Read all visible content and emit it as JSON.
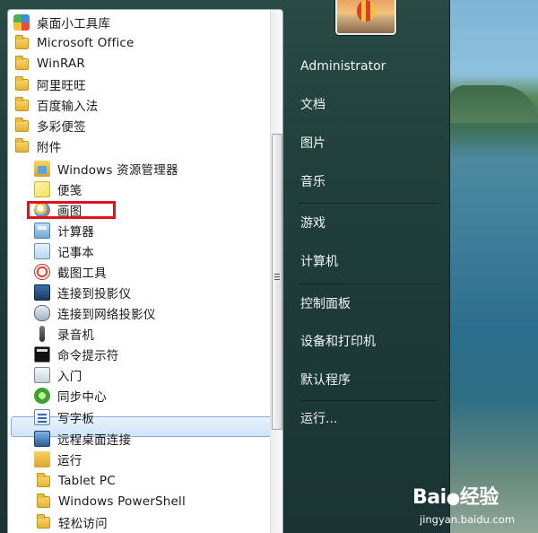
{
  "programs": {
    "folders_top": [
      {
        "label": "桌面小工具库",
        "icon": "gadget-icon"
      },
      {
        "label": "Microsoft Office",
        "icon": "folder-icon"
      },
      {
        "label": "WinRAR",
        "icon": "folder-icon"
      },
      {
        "label": "阿里旺旺",
        "icon": "folder-icon"
      },
      {
        "label": "百度输入法",
        "icon": "folder-icon"
      },
      {
        "label": "多彩便签",
        "icon": "folder-icon"
      },
      {
        "label": "附件",
        "icon": "folder-icon"
      }
    ],
    "accessories": [
      {
        "label": "Windows 资源管理器",
        "icon": "explorer-icon"
      },
      {
        "label": "便笺",
        "icon": "sticky-notes-icon"
      },
      {
        "label": "画图",
        "icon": "paint-icon"
      },
      {
        "label": "计算器",
        "icon": "calculator-icon"
      },
      {
        "label": "记事本",
        "icon": "notepad-icon"
      },
      {
        "label": "截图工具",
        "icon": "snipping-tool-icon"
      },
      {
        "label": "连接到投影仪",
        "icon": "projector-icon"
      },
      {
        "label": "连接到网络投影仪",
        "icon": "network-projector-icon"
      },
      {
        "label": "录音机",
        "icon": "sound-recorder-icon"
      },
      {
        "label": "命令提示符",
        "icon": "command-prompt-icon"
      },
      {
        "label": "入门",
        "icon": "getting-started-icon"
      },
      {
        "label": "同步中心",
        "icon": "sync-center-icon"
      },
      {
        "label": "写字板",
        "icon": "wordpad-icon"
      },
      {
        "label": "远程桌面连接",
        "icon": "remote-desktop-icon"
      },
      {
        "label": "运行",
        "icon": "run-icon"
      }
    ],
    "subfolders": [
      {
        "label": "Tablet PC",
        "icon": "folder-icon"
      },
      {
        "label": "Windows PowerShell",
        "icon": "folder-icon"
      },
      {
        "label": "轻松访问",
        "icon": "folder-icon"
      }
    ],
    "highlighted_item": "写字板",
    "annotated_item": "画图"
  },
  "right_panel": {
    "links": [
      "Administrator",
      "文档",
      "图片",
      "音乐",
      "游戏",
      "计算机",
      "控制面板",
      "设备和打印机",
      "默认程序",
      "运行..."
    ]
  },
  "watermark": {
    "logo_text": "Bai",
    "logo_suffix": "经验",
    "url": "jingyan.baidu.com"
  },
  "colors": {
    "annotation_red": "#e5101d",
    "highlight_border": "#84acdd"
  }
}
